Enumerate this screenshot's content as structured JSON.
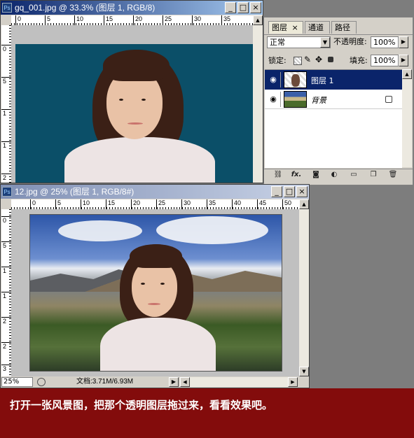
{
  "window_top": {
    "title": "gq_001.jpg @ 33.3% (图层 1, RGB/8)",
    "app_icon": "Ps",
    "ruler_h": [
      "0",
      "5",
      "10",
      "15",
      "20",
      "25",
      "30",
      "35"
    ],
    "ruler_v": [
      "0",
      "5",
      "1",
      "1",
      "2"
    ],
    "buttons": {
      "minimize": "_",
      "maximize": "□",
      "close": "×"
    },
    "canvas_color": "#0b4f68"
  },
  "window_bottom": {
    "title": "12.jpg @ 25% (图层 1, RGB/8#)",
    "app_icon": "Ps",
    "ruler_h": [
      "0",
      "5",
      "10",
      "15",
      "20",
      "25",
      "30",
      "35",
      "40",
      "45",
      "50"
    ],
    "ruler_v": [
      "0",
      "5",
      "1",
      "1",
      "2",
      "2",
      "3"
    ],
    "buttons": {
      "minimize": "_",
      "maximize": "□",
      "close": "×"
    },
    "status": {
      "zoom": "25%",
      "doc_info": "文档:3.71M/6.93M"
    }
  },
  "layers_panel": {
    "tabs": [
      "图层",
      "通道",
      "路径"
    ],
    "tab_close": "×",
    "blend_mode": "正常",
    "opacity_label": "不透明度:",
    "opacity_value": "100%",
    "lock_label": "锁定:",
    "fill_label": "填充:",
    "fill_value": "100%",
    "layers": [
      {
        "name": "图层 1",
        "selected": true
      },
      {
        "name": "背景",
        "selected": false,
        "locked": true
      }
    ],
    "footer_icons": [
      "link-icon",
      "fx-icon",
      "mask-icon",
      "adjustment-icon",
      "group-folder-icon",
      "new-layer-icon",
      "trash-icon"
    ],
    "footer_fx": "fx."
  },
  "caption": "打开一张风景图，把那个透明图层拖过来，看看效果吧。",
  "colors": {
    "active_title": "#0a246a",
    "inactive_title": "#7f8fb4",
    "caption_bg": "#830c0c",
    "selected_layer": "#0a246a"
  }
}
